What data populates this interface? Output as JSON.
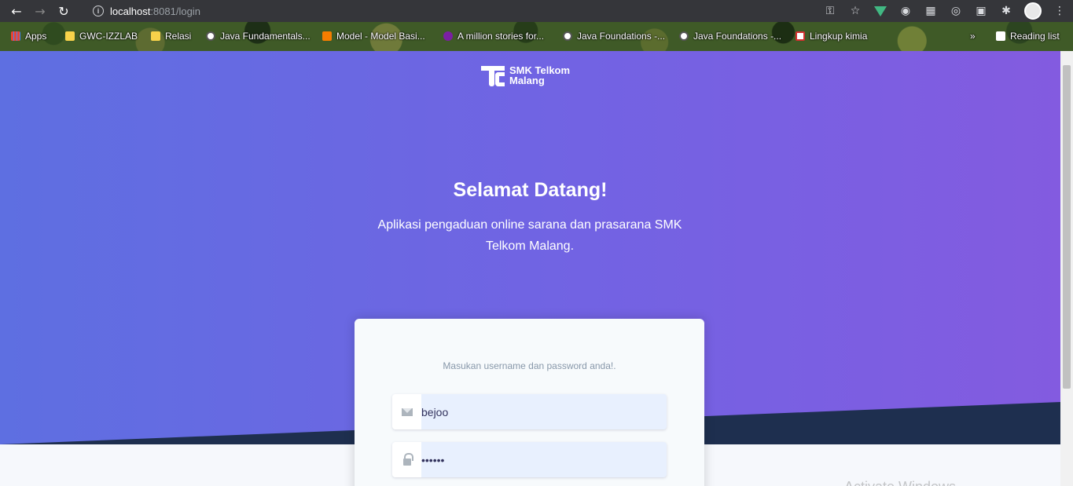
{
  "browser": {
    "url_host": "localhost",
    "url_rest": ":8081/login",
    "bookmarks": [
      {
        "label": "Apps",
        "icon": "apps-grid-icon"
      },
      {
        "label": "GWC-IZZLAB",
        "icon": "folder-icon"
      },
      {
        "label": "Relasi",
        "icon": "folder-icon"
      },
      {
        "label": "Java Fundamentals...",
        "icon": "globe-icon"
      },
      {
        "label": "Model - Model Basi...",
        "icon": "blogger-icon"
      },
      {
        "label": "A million stories for...",
        "icon": "wattpad-icon"
      },
      {
        "label": "Java Foundations -...",
        "icon": "globe-icon"
      },
      {
        "label": "Java Foundations -...",
        "icon": "globe-icon"
      },
      {
        "label": "Lingkup kimia",
        "icon": "g-icon"
      }
    ],
    "overflow": "»",
    "reading_list": "Reading list"
  },
  "brand": {
    "line1": "SMK Telkom",
    "line2": "Malang"
  },
  "hero": {
    "title": "Selamat Datang!",
    "subtitle": "Aplikasi pengaduan online sarana dan prasarana SMK Telkom Malang."
  },
  "login": {
    "hint": "Masukan username dan password anda!.",
    "username_value": "bejoo",
    "password_value": "••••••"
  },
  "watermark": "Activate Windows",
  "colors": {
    "hero_left": "#5e6fe1",
    "hero_right": "#835be0",
    "dark_wedge": "#1e2f4f"
  }
}
